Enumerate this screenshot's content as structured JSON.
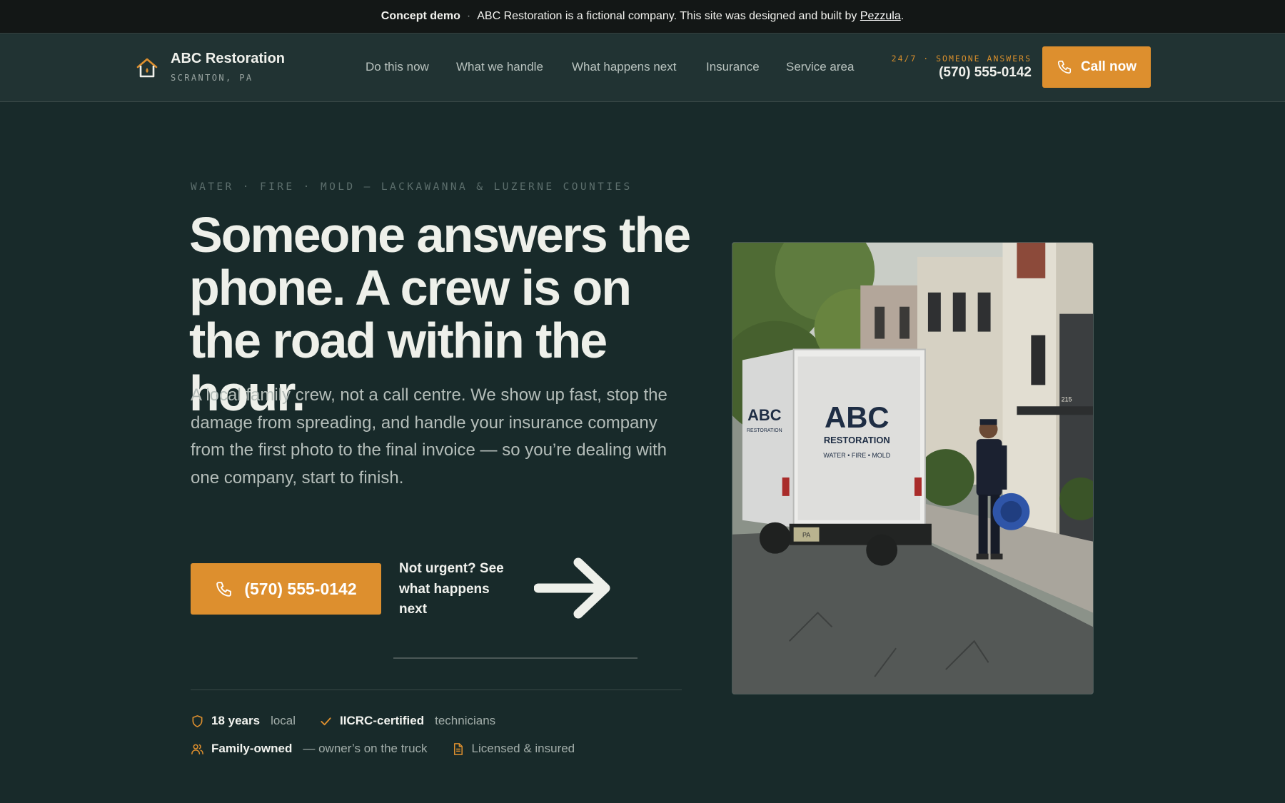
{
  "banner": {
    "label": "Concept demo",
    "separator": "·",
    "text": "ABC Restoration is a fictional company. This site was designed and built by",
    "link": "Pezzula",
    "end": "."
  },
  "brand": {
    "name": "ABC Restoration",
    "location": "SCRANTON, PA",
    "icon": "house-icon"
  },
  "nav": {
    "items": [
      {
        "label": "Do this now"
      },
      {
        "label": "What we handle"
      },
      {
        "label": "What happens next"
      },
      {
        "label": "Insurance"
      },
      {
        "label": "Service area"
      }
    ]
  },
  "header_call": {
    "tag": "24/7 · SOMEONE ANSWERS",
    "number": "(570) 555-0142",
    "button_label": "Call now",
    "icon": "phone-icon"
  },
  "hero": {
    "eyebrow": "WATER · FIRE · MOLD — LACKAWANNA & LUZERNE COUNTIES",
    "headline": "Someone answers the phone. A crew is on the road within the hour.",
    "lede": "A local family crew, not a call centre. We show up fast, stop the damage from spreading, and handle your insurance company from the first photo to the final invoice — so you’re dealing with one company, start to finish.",
    "phone_button": "(570) 555-0142",
    "secondary_link": "Not urgent? See what happens next",
    "arrow_icon": "arrow-right-icon"
  },
  "trust": {
    "row1": [
      {
        "icon": "shield-icon",
        "bold": "18 years",
        "rest": "local"
      },
      {
        "icon": "check-icon",
        "bold": "IICRC-certified",
        "rest": "technicians"
      }
    ],
    "row2": [
      {
        "icon": "users-icon",
        "bold": "Family-owned",
        "rest": "— owner’s on the truck"
      },
      {
        "icon": "document-icon",
        "bold": "",
        "rest": "Licensed & insured"
      }
    ]
  },
  "photo": {
    "truck_logo": "ABC",
    "truck_sub": "RESTORATION",
    "truck_tag": "WATER • FIRE • MOLD",
    "side_logo": "ABC",
    "side_sub": "RESTORATION",
    "plate": "PA",
    "house_number": "215"
  },
  "colors": {
    "background": "#182a2a",
    "header": "#213333",
    "banner": "#131716",
    "accent": "#dd8f2e",
    "text": "#eef0ea",
    "muted": "#b4bdb9"
  }
}
